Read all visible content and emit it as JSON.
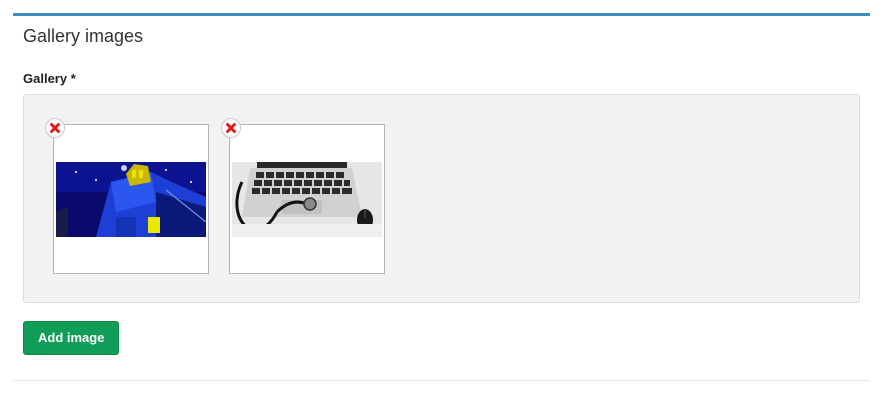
{
  "panel": {
    "title": "Gallery images",
    "accent_color": "#3c8dbc"
  },
  "gallery": {
    "label": "Gallery *",
    "images": [
      {
        "alt": "blue neon building at night",
        "remove_icon": "remove-x-icon"
      },
      {
        "alt": "laptop keyboard with stethoscope and mouse",
        "remove_icon": "remove-x-icon"
      }
    ]
  },
  "actions": {
    "add_image_label": "Add image",
    "add_image_color": "#0f9d58"
  }
}
